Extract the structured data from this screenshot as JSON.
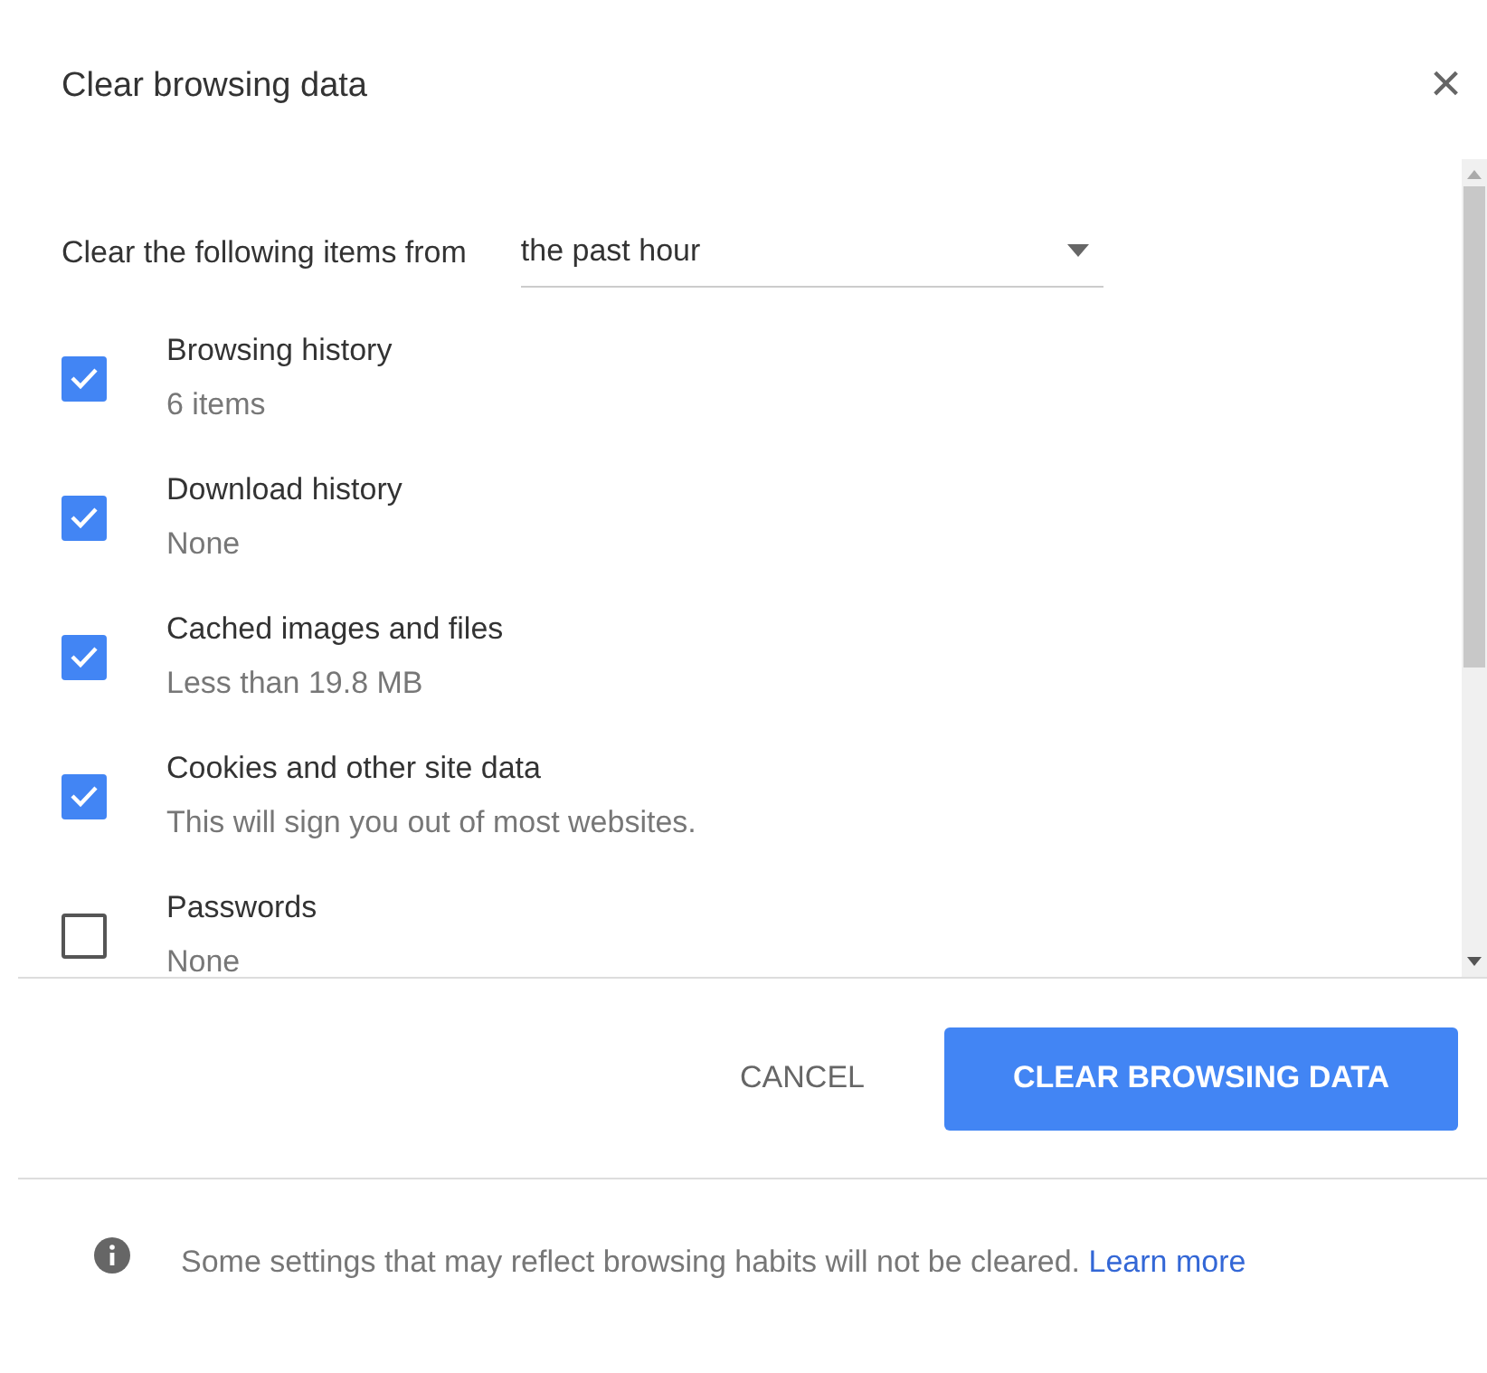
{
  "dialog": {
    "title": "Clear browsing data",
    "close": "×"
  },
  "range": {
    "label": "Clear the following items from",
    "value": "the past hour"
  },
  "items": [
    {
      "label": "Browsing history",
      "detail": "6 items",
      "checked": true
    },
    {
      "label": "Download history",
      "detail": "None",
      "checked": true
    },
    {
      "label": "Cached images and files",
      "detail": "Less than 19.8 MB",
      "checked": true
    },
    {
      "label": "Cookies and other site data",
      "detail": "This will sign you out of most websites.",
      "checked": true
    },
    {
      "label": "Passwords",
      "detail": "None",
      "checked": false
    }
  ],
  "buttons": {
    "cancel": "CANCEL",
    "confirm": "CLEAR BROWSING DATA"
  },
  "footer": {
    "text": "Some settings that may reflect browsing habits will not be cleared.",
    "link": "Learn more"
  }
}
